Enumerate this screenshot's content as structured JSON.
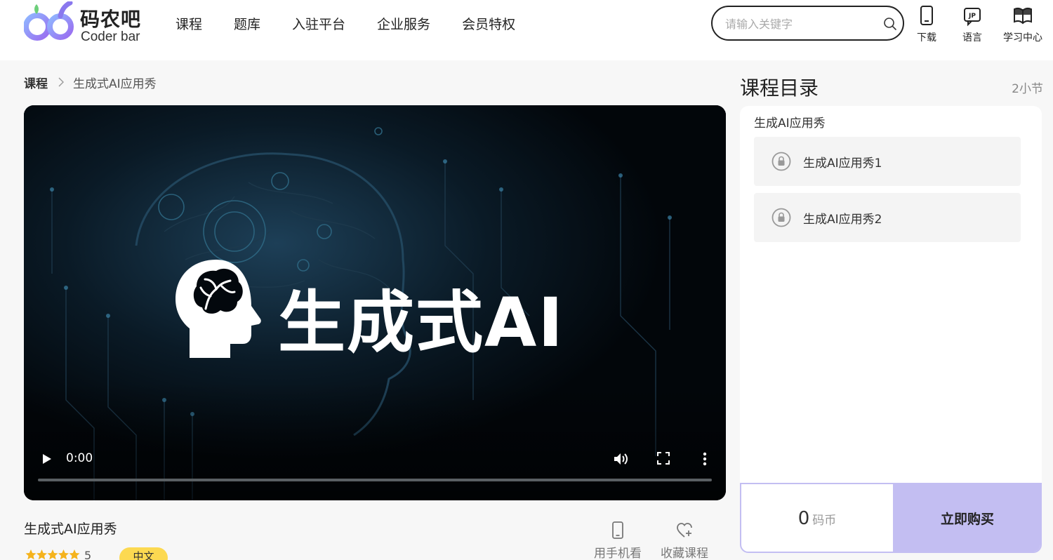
{
  "header": {
    "logo": {
      "name_cn": "码农吧",
      "name_en": "Coder bar"
    },
    "nav": [
      "课程",
      "题库",
      "入驻平台",
      "企业服务",
      "会员特权"
    ],
    "search": {
      "placeholder": "请输入关键字",
      "value": ""
    },
    "tools": {
      "download": "下载",
      "language": "语言",
      "learning_center": "学习中心"
    }
  },
  "breadcrumb": {
    "root": "课程",
    "current": "生成式AI应用秀"
  },
  "video": {
    "overlay_title": "生成式AI",
    "time": "0:00",
    "progress": 0
  },
  "course": {
    "name": "生成式AI应用秀",
    "rating": 5,
    "rating_label": "5",
    "language": "中文",
    "watch_on_phone": "用手机看",
    "favorite": "收藏课程"
  },
  "toc": {
    "title": "课程目录",
    "count": "2小节",
    "chapter": "生成AI应用秀",
    "lessons": [
      {
        "title": "生成AI应用秀1",
        "locked": true
      },
      {
        "title": "生成AI应用秀2",
        "locked": true
      }
    ]
  },
  "purchase": {
    "price": "0",
    "unit": "码币",
    "buy_label": "立即购买"
  },
  "colors": {
    "accent": "#c3bef2",
    "badge": "#fcd951",
    "video_bg": "#03080d",
    "star": "#f5b31c"
  },
  "icons": {
    "search": "search-icon",
    "download": "phone-icon",
    "language": "language-icon",
    "learning_center": "book-icon",
    "lock": "lock-icon",
    "play": "play-icon",
    "volume": "volume-icon",
    "fullscreen": "fullscreen-icon",
    "more": "more-vertical-icon",
    "favorite": "heart-plus-icon"
  }
}
